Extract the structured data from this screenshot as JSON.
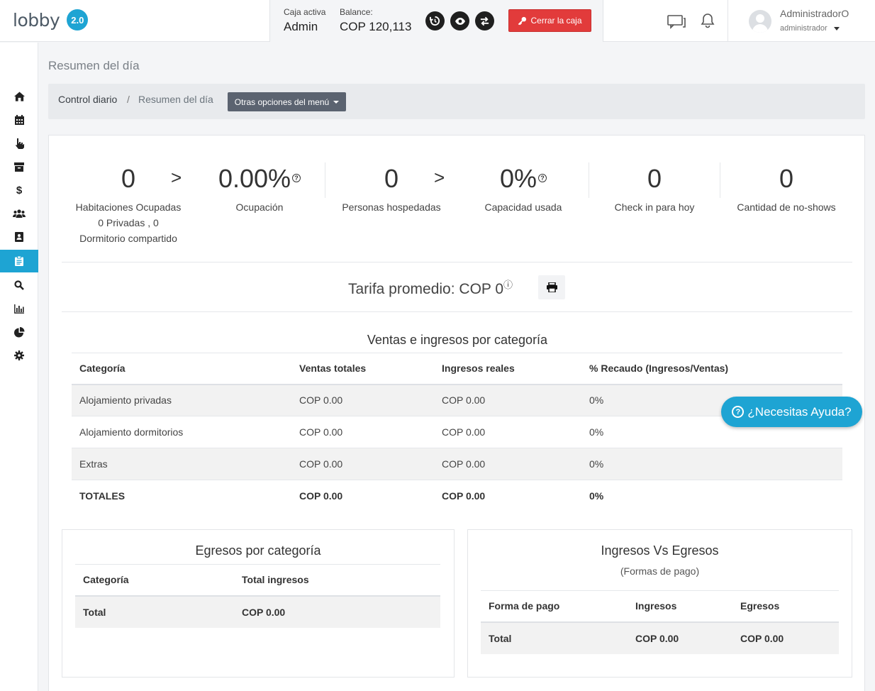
{
  "brand": {
    "name": "lobby",
    "version": "2.0"
  },
  "cashbox": {
    "active_label": "Caja activa",
    "active_value": "Admin",
    "balance_label": "Balance:",
    "balance_value": "COP 120,113",
    "close_label": "Cerrar la caja"
  },
  "user": {
    "name": "AdministradorO",
    "role": "administrador"
  },
  "sidebar": {
    "items": [
      {
        "icon": "home-icon"
      },
      {
        "icon": "calendar-icon"
      },
      {
        "icon": "pointer-hand-icon"
      },
      {
        "icon": "archive-icon"
      },
      {
        "icon": "dollar-icon"
      },
      {
        "icon": "users-icon"
      },
      {
        "icon": "contact-book-icon"
      },
      {
        "icon": "clipboard-icon",
        "active": true
      },
      {
        "icon": "search-icon"
      },
      {
        "icon": "bar-chart-icon"
      },
      {
        "icon": "pie-chart-icon"
      },
      {
        "icon": "gear-icon"
      }
    ],
    "active_color": "#1ea4d3"
  },
  "page": {
    "title": "Resumen del día",
    "breadcrumb": {
      "root": "Control diario",
      "separator": "/",
      "current": "Resumen del día"
    },
    "menu_button": "Otras opciones del menú"
  },
  "stats": {
    "rooms_occupied": {
      "value": "0",
      "label_1": "Habitaciones Ocupadas",
      "label_2": "0 Privadas , 0",
      "label_3": "Dormitorio compartido"
    },
    "arrow_1": ">",
    "occupancy": {
      "value": "0.00%",
      "label": "Ocupación"
    },
    "guests": {
      "value": "0",
      "label": "Personas hospedadas"
    },
    "arrow_2": ">",
    "capacity": {
      "value": "0%",
      "label": "Capacidad usada"
    },
    "checkin": {
      "value": "0",
      "label": "Check in para hoy"
    },
    "noshows": {
      "value": "0",
      "label": "Cantidad de no-shows"
    }
  },
  "tarifa": {
    "text": "Tarifa promedio: COP 0"
  },
  "sales": {
    "title": "Ventas e ingresos por categoría",
    "headers": [
      "Categoría",
      "Ventas totales",
      "Ingresos reales",
      "% Recaudo (Ingresos/Ventas)"
    ],
    "rows": [
      [
        "Alojamiento privadas",
        "COP 0.00",
        "COP 0.00",
        "0%"
      ],
      [
        "Alojamiento dormitorios",
        "COP 0.00",
        "COP 0.00",
        "0%"
      ],
      [
        "Extras",
        "COP 0.00",
        "COP 0.00",
        "0%"
      ],
      [
        "TOTALES",
        "COP 0.00",
        "COP 0.00",
        "0%"
      ]
    ]
  },
  "expenses": {
    "title": "Egresos por categoría",
    "headers": [
      "Categoría",
      "Total ingresos"
    ],
    "rows": [
      [
        "Total",
        "COP 0.00"
      ]
    ]
  },
  "income_vs_expenses": {
    "title": "Ingresos Vs Egresos",
    "subtitle": "(Formas de pago)",
    "headers": [
      "Forma de pago",
      "Ingresos",
      "Egresos"
    ],
    "rows": [
      [
        "Total",
        "COP 0.00",
        "COP 0.00"
      ]
    ]
  },
  "help": {
    "label": "¿Necesitas Ayuda?",
    "color": "#1ea4d3"
  }
}
